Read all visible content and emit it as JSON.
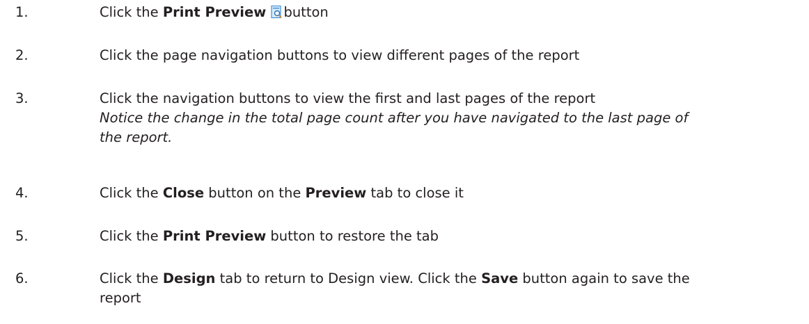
{
  "steps": [
    {
      "number": "1.",
      "pre": "Click the ",
      "bold": "Print Preview",
      "icon": "print-preview-icon",
      "post": "button"
    },
    {
      "number": "2.",
      "text": "Click the page navigation buttons to view different pages of the report"
    },
    {
      "number": "3.",
      "text": "Click the navigation buttons to view the first and last pages of the report",
      "note_line1": "Notice the change in the total page count after you have navigated to the last page of",
      "note_line2": "the report."
    },
    {
      "number": "4.",
      "pre": "Click the ",
      "bold1": "Close",
      "mid": " button on the ",
      "bold2": "Preview",
      "post": " tab to close it"
    },
    {
      "number": "5.",
      "pre": "Click the ",
      "bold": "Print Preview",
      "post": " button to restore the tab"
    },
    {
      "number": "6.",
      "pre": "Click the ",
      "bold1": "Design",
      "mid": " tab to return to Design view. Click the ",
      "bold2": "Save",
      "post": " button again to save the",
      "line2": "report"
    }
  ],
  "colors": {
    "text": "#231f20",
    "icon_blue": "#3f8fd8",
    "icon_light": "#d9ecfb"
  }
}
